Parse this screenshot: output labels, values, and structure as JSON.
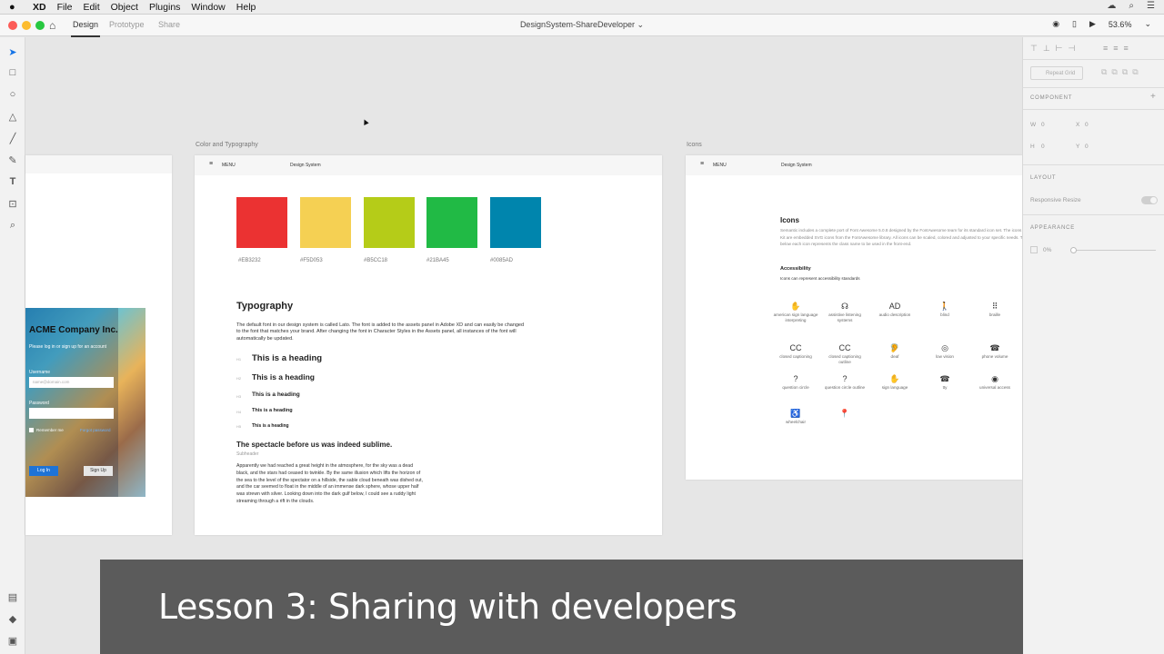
{
  "menubar": {
    "app": "XD",
    "items": [
      "File",
      "Edit",
      "Object",
      "Plugins",
      "Window",
      "Help"
    ]
  },
  "titlebar": {
    "tabs": [
      "Design",
      "Prototype",
      "Share"
    ],
    "doc_title": "DesignSystem-ShareDeveloper",
    "zoom": "53.6%"
  },
  "canvas": {
    "cursor": "▲",
    "artboard1_label": "Color and Typography",
    "artboard2_label": "Icons",
    "nav_menu": "MENU",
    "nav_title": "Design System",
    "swatches": [
      {
        "color": "#EB3232",
        "hex": "#EB3232"
      },
      {
        "color": "#F5D053",
        "hex": "#F5D053"
      },
      {
        "color": "#B5CC18",
        "hex": "#B5CC18"
      },
      {
        "color": "#21BA45",
        "hex": "#21BA45"
      },
      {
        "color": "#0085AD",
        "hex": "#0085AD"
      }
    ],
    "typography": {
      "title": "Typography",
      "intro": "The default font in our design system is called Lato. The font is added to the assets panel in Adobe XD and can easily be changed to the font that matches your brand. After changing the font in Character Styles in the Assets panel, all instances of the font will automatically be updated.",
      "headings": [
        {
          "tag": "H1",
          "text": "This is a heading"
        },
        {
          "tag": "H2",
          "text": "This is a heading"
        },
        {
          "tag": "H3",
          "text": "This is a heading"
        },
        {
          "tag": "H4",
          "text": "This is a heading"
        },
        {
          "tag": "H5",
          "text": "This is a heading"
        }
      ],
      "quote_title": "The spectacle before us was indeed sublime.",
      "subheader": "Subheader",
      "body": "Apparently we had reached a great height in the atmosphere, for the sky was a dead black, and the stars had ceased to twinkle. By the same illusion which lifts the horizon of the sea to the level of the spectator on a hillside, the sable cloud beneath was dished out, and the car seemed to float in the middle of an immense dark sphere, whose upper half was strewn with silver. Looking down into the dark gulf below, I could see a ruddy light streaming through a rift in the clouds."
    },
    "login": {
      "company": "ACME Company Inc.",
      "prompt": "Please log in or sign up for an account",
      "username_label": "Username",
      "username_placeholder": "name@domain.com",
      "password_label": "Password",
      "remember": "Remember me",
      "forgot": "Forgot password",
      "login_btn": "Log In",
      "signup_btn": "Sign Up"
    },
    "icons_board": {
      "title": "Icons",
      "desc": "Semantic includes a complete port of Font Awesome 5.0.8 designed by the FontAwesome team for its standard icon set. The icons in this UI Kit are embedded SVG icons from the FontAwesome library. All icons can be scaled, colored and adjusted to your specific needs. The label below each icon represents the class name to be used in the front-end.",
      "section": "Accessibility",
      "section_sub": "Icons can represent accessibility standards",
      "icons": [
        {
          "glyph": "✋",
          "label": "american sign language interpreting"
        },
        {
          "glyph": "☊",
          "label": "assistive listening systems"
        },
        {
          "glyph": "AD",
          "label": "audio description"
        },
        {
          "glyph": "🚶",
          "label": "blind"
        },
        {
          "glyph": "⠿",
          "label": "braille"
        },
        {
          "glyph": "CC",
          "label": "closed captioning"
        },
        {
          "glyph": "CC",
          "label": "closed captioning outline"
        },
        {
          "glyph": "🦻",
          "label": "deaf"
        },
        {
          "glyph": "◎",
          "label": "low vision"
        },
        {
          "glyph": "☎",
          "label": "phone volume"
        },
        {
          "glyph": "?",
          "label": "question circle"
        },
        {
          "glyph": "?",
          "label": "question circle outline"
        },
        {
          "glyph": "✋",
          "label": "sign language"
        },
        {
          "glyph": "☎",
          "label": "tty"
        },
        {
          "glyph": "◉",
          "label": "universal access"
        },
        {
          "glyph": "♿",
          "label": "wheelchair"
        },
        {
          "glyph": "📍",
          "label": ""
        }
      ]
    }
  },
  "right_panel": {
    "repeat_grid": "Repeat Grid",
    "component": "COMPONENT",
    "w_label": "W",
    "w_value": "0",
    "x_label": "X",
    "x_value": "0",
    "h_label": "H",
    "h_value": "0",
    "y_label": "Y",
    "y_value": "0",
    "layout": "LAYOUT",
    "responsive": "Responsive Resize",
    "appearance": "APPEARANCE",
    "opacity": "0%"
  },
  "banner": {
    "text": "Lesson 3: Sharing with developers"
  }
}
